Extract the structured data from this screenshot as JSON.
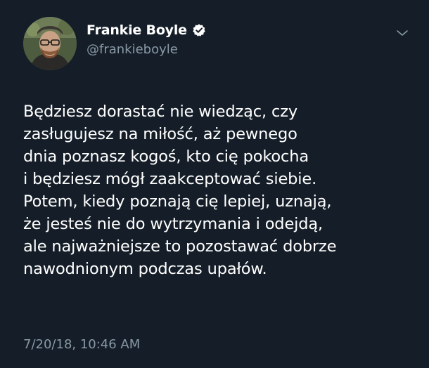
{
  "tweet": {
    "author": {
      "display_name": "Frankie Boyle",
      "handle": "@frankieboyle",
      "verified": true,
      "avatar_icon": "avatar-photo"
    },
    "menu_icon": "chevron-down-icon",
    "text_lines": [
      "Będziesz dorastać nie wiedząc, czy",
      "zasługujesz na miłość, aż pewnego",
      "dnia poznasz kogoś, kto cię pokocha",
      "i będziesz mógł zaakceptować siebie.",
      "Potem, kiedy poznają cię lepiej, uznają,",
      "że jesteś nie do wytrzymania i odejdą,",
      "ale najważniejsze to pozostawać dobrze",
      "nawodnionym podczas upałów."
    ],
    "timestamp": "7/20/18, 10:46 AM"
  },
  "colors": {
    "background": "#151e28",
    "text": "#ffffff",
    "secondary_text": "#8899a6",
    "verified_badge": "#ffffff"
  }
}
